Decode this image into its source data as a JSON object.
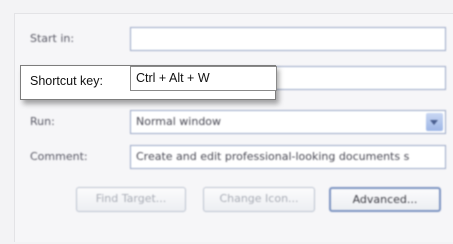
{
  "fields": {
    "start_in_label": "Start in:",
    "start_in_value": "",
    "shortcut_label": "Shortcut key:",
    "shortcut_value": "Ctrl + Alt + W",
    "run_label": "Run:",
    "run_value": "Normal window",
    "comment_label": "Comment:",
    "comment_value": "Create and edit professional-looking documents s"
  },
  "buttons": {
    "find_target": "Find Target...",
    "change_icon": "Change Icon...",
    "advanced": "Advanced..."
  },
  "icons": {
    "run_dropdown": "chevron-down-icon"
  }
}
